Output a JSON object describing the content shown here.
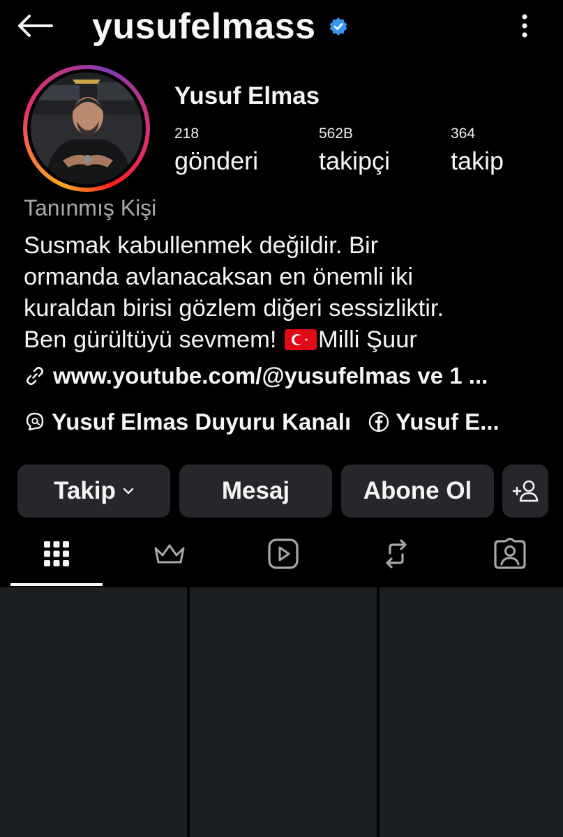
{
  "header": {
    "back_icon": "arrow-left-icon",
    "username": "yusufelmass",
    "verified_icon": "verified-badge-icon",
    "more_icon": "more-vertical-icon"
  },
  "profile": {
    "display_name": "Yusuf Elmas",
    "stats": [
      {
        "value": "218",
        "label": "gönderi"
      },
      {
        "value": "562B",
        "label": "takipçi"
      },
      {
        "value": "364",
        "label": "takip"
      }
    ],
    "category": "Tanınmış Kişi",
    "bio_text": "Susmak kabullenmek değildir. Bir\normanda avlanacaksan en önemli iki\nkuraldan birisi gözlem diğeri sessizliktir.\nBen gürültüyü sevmem! ",
    "bio_suffix": "Milli Şuur",
    "link": "www.youtube.com/@yusufelmas ve 1 ...",
    "channels": [
      {
        "label": "Yusuf Elmas Duyuru Kanalı",
        "icon": "threads-icon"
      },
      {
        "label": "Yusuf E...",
        "icon": "facebook-icon"
      }
    ]
  },
  "actions": {
    "follow": "Takip",
    "message": "Mesaj",
    "subscribe": "Abone Ol",
    "suggest_icon": "add-person-icon"
  },
  "tabs": [
    {
      "name": "posts",
      "icon": "grid-icon",
      "active": true
    },
    {
      "name": "subscriptions",
      "icon": "crown-icon",
      "active": false
    },
    {
      "name": "reels",
      "icon": "play-icon",
      "active": false
    },
    {
      "name": "reposts",
      "icon": "repost-icon",
      "active": false
    },
    {
      "name": "tagged",
      "icon": "tagged-person-icon",
      "active": false
    }
  ],
  "colors": {
    "background": "#000000",
    "button": "#25272b",
    "grid_cell": "#1c1f22",
    "muted_text": "#a8a8a8",
    "verified": "#3897f0"
  }
}
